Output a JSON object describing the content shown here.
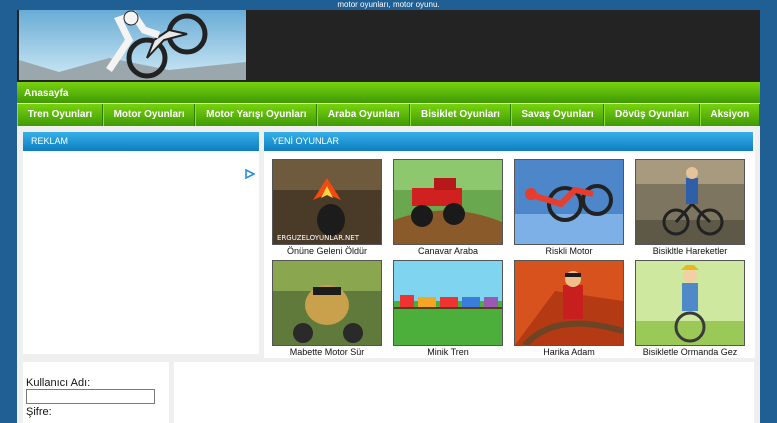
{
  "topbar": {
    "text": "motor oyunları, motor oyunu."
  },
  "nav": {
    "home": "Anasayfa"
  },
  "categories": [
    "Tren Oyunları",
    "Motor Oyunları",
    "Motor Yarışı Oyunları",
    "Araba Oyunları",
    "Bisiklet Oyunları",
    "Savaş Oyunları",
    "Dövüş Oyunları",
    "Aksiyon"
  ],
  "ad": {
    "title": "REKLAM"
  },
  "new_games": {
    "title": "YENİ OYUNLAR",
    "watermark": "ERGUZELOYUNLAR.NET",
    "items": [
      "Önüne Geleni Öldür",
      "Canavar Araba",
      "Riskli Motor",
      "Bisikltle Hareketler",
      "Mabette Motor Sür",
      "Minik Tren",
      "Harika Adam",
      "Bisikletle Ormanda Gez"
    ]
  },
  "login": {
    "username_label": "Kullanıcı Adı:",
    "password_label": "Şifre:"
  },
  "colors": {
    "page_bg": "#1f5f93",
    "nav_green": "#5cb80a",
    "panel_blue": "#1a8fd0"
  }
}
